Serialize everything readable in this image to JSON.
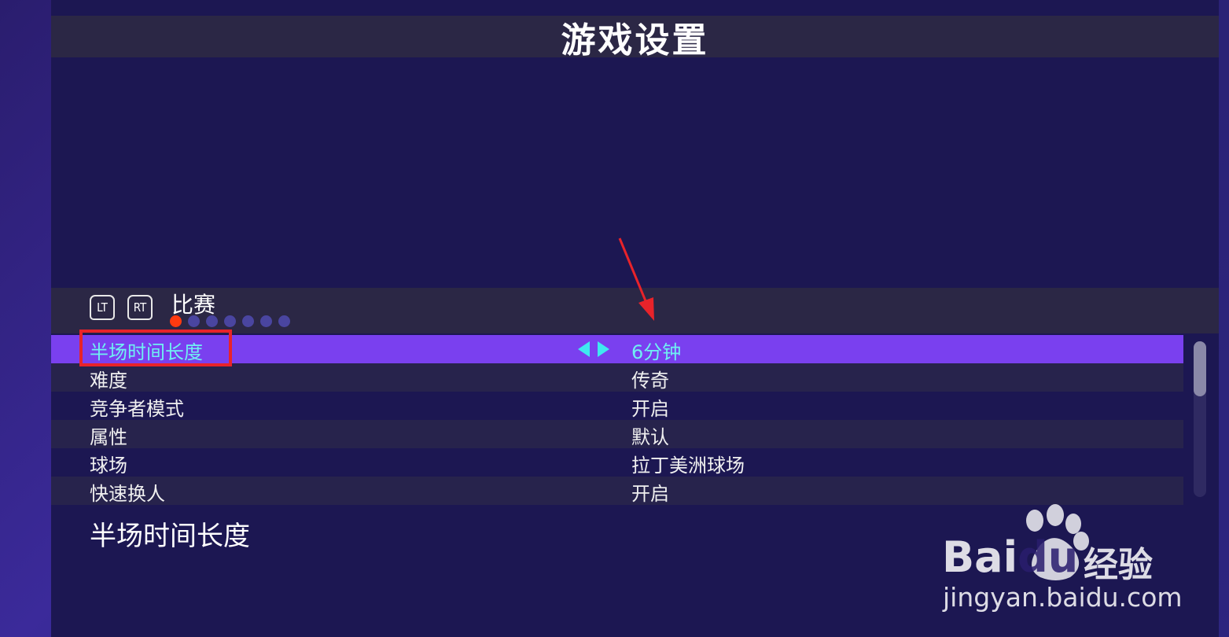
{
  "header": {
    "title": "游戏设置"
  },
  "tab_bar": {
    "lt_label": "LT",
    "rt_label": "RT",
    "current_tab": "比赛",
    "page_dots": 7,
    "active_dot": 0
  },
  "settings": {
    "rows": [
      {
        "label": "半场时间长度",
        "value": "6分钟",
        "selected": true
      },
      {
        "label": "难度",
        "value": "传奇",
        "selected": false
      },
      {
        "label": "竞争者模式",
        "value": "开启",
        "selected": false
      },
      {
        "label": "属性",
        "value": "默认",
        "selected": false
      },
      {
        "label": "球场",
        "value": "拉丁美洲球场",
        "selected": false
      },
      {
        "label": "快速换人",
        "value": "开启",
        "selected": false
      }
    ]
  },
  "description": {
    "text": "半场时间长度"
  },
  "watermark": {
    "brand": "Bai",
    "brand2": "du",
    "suffix": "经验",
    "url": "jingyan.baidu.com"
  },
  "colors": {
    "selected_row": "#7a40ef",
    "selected_text": "#6ff0f2",
    "active_dot": "#ff3a10",
    "annotation_red": "#e8232a"
  }
}
